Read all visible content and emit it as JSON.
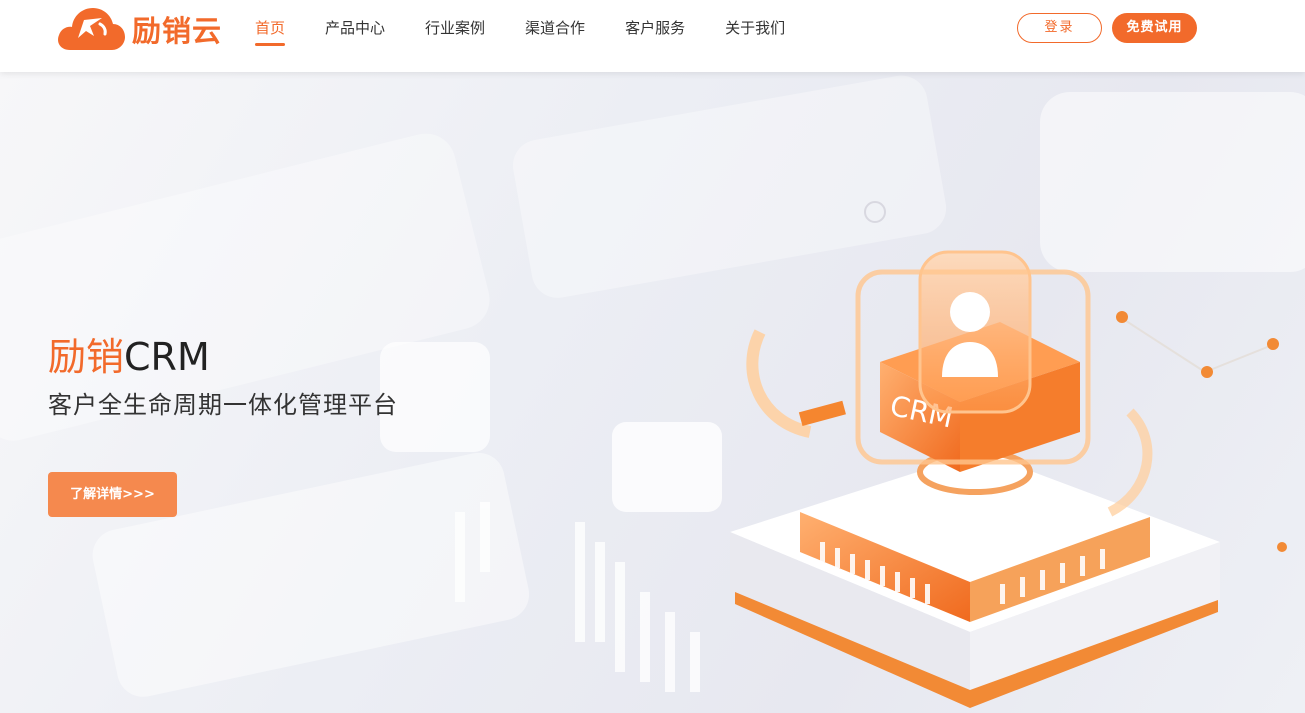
{
  "header": {
    "logo_text": "励销云",
    "nav": [
      {
        "label": "首页",
        "active": true
      },
      {
        "label": "产品中心",
        "active": false
      },
      {
        "label": "行业案例",
        "active": false
      },
      {
        "label": "渠道合作",
        "active": false
      },
      {
        "label": "客户服务",
        "active": false
      },
      {
        "label": "关于我们",
        "active": false
      }
    ],
    "login_label": "登录",
    "trial_label": "免费试用"
  },
  "hero": {
    "title_accent": "励销",
    "title_rest": "CRM",
    "subtitle": "客户全生命周期一体化管理平台",
    "detail_label": "了解详情>>>",
    "illustration_text": "CRM"
  },
  "colors": {
    "brand": "#f26a2b",
    "button_detail": "#f5894e"
  }
}
